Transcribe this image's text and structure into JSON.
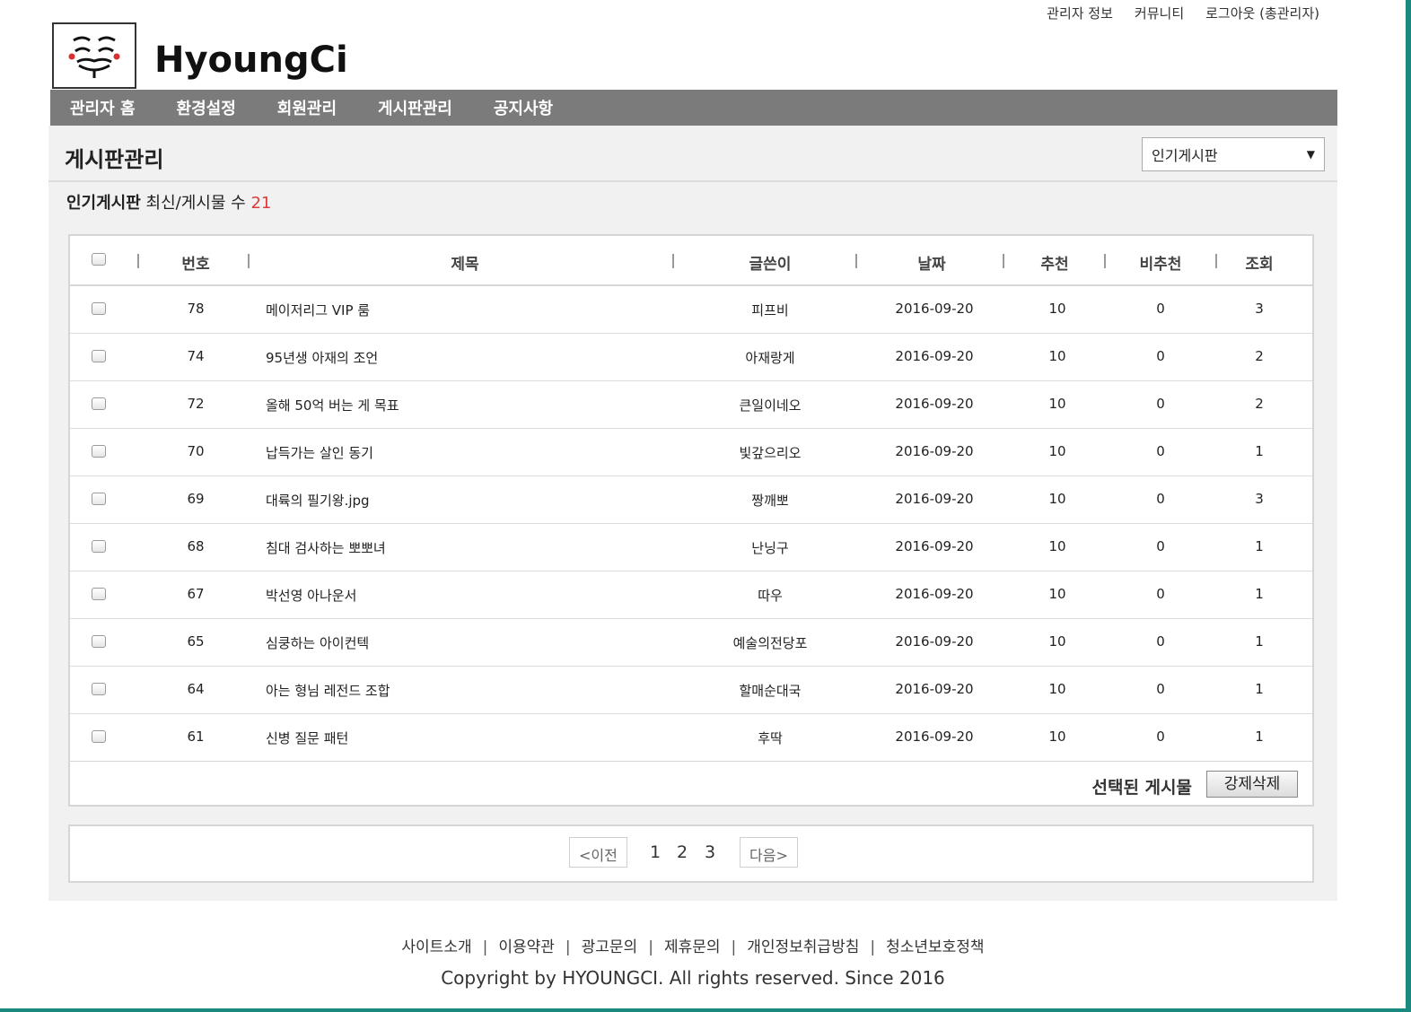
{
  "top_links": [
    "관리자 정보",
    "커뮤니티",
    "로그아웃 (총관리자)"
  ],
  "brand": "HyoungCi",
  "nav": [
    "관리자 홈",
    "환경설정",
    "회원관리",
    "게시판관리",
    "공지사항"
  ],
  "page": {
    "title": "게시판관리",
    "board_select": "인기게시판",
    "board_name": "인기게시판",
    "board_desc": "최신/게시물 수",
    "board_count": "21"
  },
  "table": {
    "headers": {
      "num": "번호",
      "subject": "제목",
      "writer": "글쓴이",
      "date": "날짜",
      "up": "추천",
      "down": "비추천",
      "views": "조회"
    },
    "rows": [
      {
        "num": "78",
        "subject": "메이저리그 VIP 룸",
        "writer": "피프비",
        "date": "2016-09-20",
        "up": "10",
        "down": "0",
        "views": "3"
      },
      {
        "num": "74",
        "subject": "95년생 아재의 조언",
        "writer": "아재랑게",
        "date": "2016-09-20",
        "up": "10",
        "down": "0",
        "views": "2"
      },
      {
        "num": "72",
        "subject": "올해 50억 버는 게 목표",
        "writer": "큰일이네오",
        "date": "2016-09-20",
        "up": "10",
        "down": "0",
        "views": "2"
      },
      {
        "num": "70",
        "subject": "납득가는 살인 동기",
        "writer": "빛갚으리오",
        "date": "2016-09-20",
        "up": "10",
        "down": "0",
        "views": "1"
      },
      {
        "num": "69",
        "subject": "대륙의 필기왕.jpg",
        "writer": "짱깨뽀",
        "date": "2016-09-20",
        "up": "10",
        "down": "0",
        "views": "3"
      },
      {
        "num": "68",
        "subject": "침대 검사하는 뽀뽀녀",
        "writer": "난닝구",
        "date": "2016-09-20",
        "up": "10",
        "down": "0",
        "views": "1"
      },
      {
        "num": "67",
        "subject": "박선영 아나운서",
        "writer": "따우",
        "date": "2016-09-20",
        "up": "10",
        "down": "0",
        "views": "1"
      },
      {
        "num": "65",
        "subject": "심쿵하는 아이컨텍",
        "writer": "예술의전당포",
        "date": "2016-09-20",
        "up": "10",
        "down": "0",
        "views": "1"
      },
      {
        "num": "64",
        "subject": "아는 형님 레전드 조합",
        "writer": "할매순대국",
        "date": "2016-09-20",
        "up": "10",
        "down": "0",
        "views": "1"
      },
      {
        "num": "61",
        "subject": "신병 질문 패턴",
        "writer": "후딱",
        "date": "2016-09-20",
        "up": "10",
        "down": "0",
        "views": "1"
      }
    ],
    "selected_label": "선택된 게시물",
    "delete_button": "강제삭제"
  },
  "pager": {
    "prev": "<이전",
    "pages": [
      "1",
      "2",
      "3"
    ],
    "next": "다음>"
  },
  "footer": {
    "links": [
      "사이트소개",
      "이용약관",
      "광고문의",
      "제휴문의",
      "개인정보취급방침",
      "청소년보호정책"
    ],
    "copyright": "Copyright by HYOUNGCI. All rights reserved. Since 2016"
  },
  "colors": {
    "nav_bg": "#7b7b7b",
    "count_red": "#e03a3a",
    "frame_teal": "#1a8a7e"
  },
  "icons": {
    "logo": "guy-fawkes-mask-icon",
    "select_arrow": "triangle-down-icon"
  }
}
